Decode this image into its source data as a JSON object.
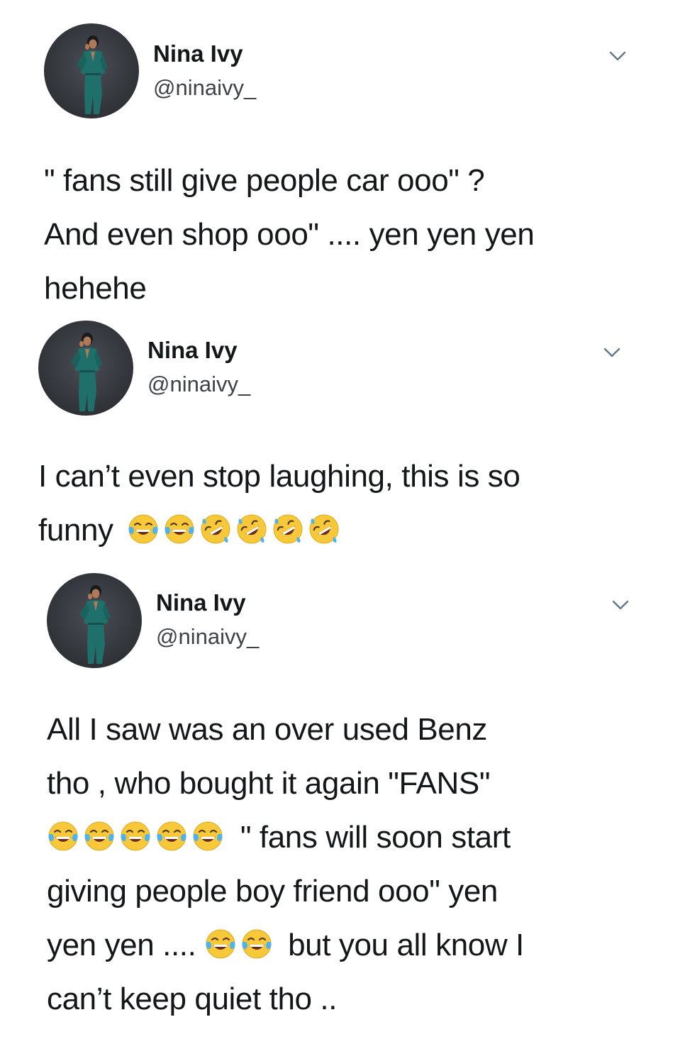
{
  "tweets": [
    {
      "name": "Nina Ivy",
      "handle": "@ninaivy_",
      "menu_icon": "chevron-down-icon",
      "lines": [
        "\" fans still give people car ooo\" ?",
        "And even shop ooo\" .... yen yen yen",
        "hehehe"
      ]
    },
    {
      "name": "Nina Ivy",
      "handle": "@ninaivy_",
      "menu_icon": "chevron-down-icon",
      "lines": [
        "I can’t even stop laughing, this is so",
        "funny"
      ],
      "emojis": [
        "face-with-tears-of-joy",
        "face-with-tears-of-joy",
        "rolling-on-the-floor-laughing",
        "rolling-on-the-floor-laughing",
        "rolling-on-the-floor-laughing",
        "rolling-on-the-floor-laughing"
      ]
    },
    {
      "name": "Nina Ivy",
      "handle": "@ninaivy_",
      "menu_icon": "chevron-down-icon",
      "lines": [
        "All I saw was an over used Benz",
        "tho , who bought it again \"FANS\"",
        "\" fans will soon start",
        "giving people boy friend ooo\" yen",
        "yen yen ....",
        "but you all know I",
        "can’t keep quiet tho .."
      ],
      "emojis_line3": [
        "face-with-tears-of-joy",
        "face-with-tears-of-joy",
        "face-with-tears-of-joy",
        "face-with-tears-of-joy",
        "face-with-tears-of-joy"
      ],
      "emojis_line5": [
        "face-with-tears-of-joy",
        "face-with-tears-of-joy"
      ]
    }
  ]
}
